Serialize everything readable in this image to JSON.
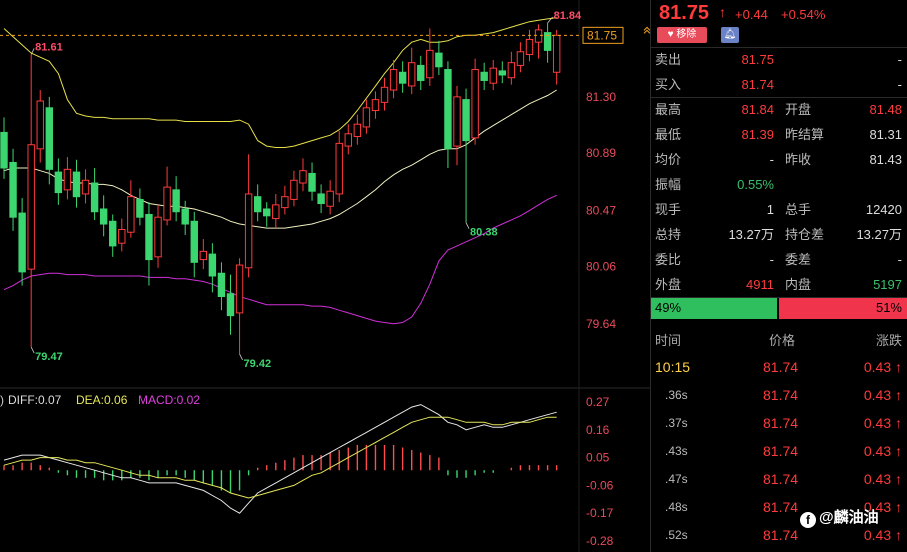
{
  "quote": {
    "price": "81.75",
    "arrow": "↑",
    "change": "+0.44",
    "change_pct": "+0.54%",
    "remove_label": "移除",
    "bell_icon": "bell-icon"
  },
  "stats": [
    {
      "l1": "卖出",
      "v1": "81.75",
      "c1": "red",
      "l2": "",
      "v2": "-",
      "c2": "white"
    },
    {
      "l1": "买入",
      "v1": "81.74",
      "c1": "red",
      "l2": "",
      "v2": "-",
      "c2": "white"
    },
    {
      "l1": "最高",
      "v1": "81.84",
      "c1": "red",
      "l2": "开盘",
      "v2": "81.48",
      "c2": "red"
    },
    {
      "l1": "最低",
      "v1": "81.39",
      "c1": "red",
      "l2": "昨结算",
      "v2": "81.31",
      "c2": "white"
    },
    {
      "l1": "均价",
      "v1": "-",
      "c1": "white",
      "l2": "昨收",
      "v2": "81.43",
      "c2": "white"
    },
    {
      "l1": "振幅",
      "v1": "0.55%",
      "c1": "green",
      "l2": "",
      "v2": "",
      "c2": "white"
    },
    {
      "l1": "现手",
      "v1": "1",
      "c1": "white",
      "l2": "总手",
      "v2": "12420",
      "c2": "white"
    },
    {
      "l1": "总持",
      "v1": "13.27万",
      "c1": "white",
      "l2": "持仓差",
      "v2": "13.27万",
      "c2": "white"
    },
    {
      "l1": "委比",
      "v1": "-",
      "c1": "white",
      "l2": "委差",
      "v2": "-",
      "c2": "white"
    },
    {
      "l1": "外盘",
      "v1": "4911",
      "c1": "red",
      "l2": "内盘",
      "v2": "5197",
      "c2": "green"
    }
  ],
  "ratio": {
    "buy_pct": 49,
    "buy_label": "49%",
    "sell_label": "51%"
  },
  "trades_header": {
    "time": "时间",
    "price": "价格",
    "change": "涨跌"
  },
  "trades": [
    {
      "time": "10:15",
      "price": "81.74",
      "change": "0.43"
    },
    {
      "time": ".36s",
      "price": "81.74",
      "change": "0.43"
    },
    {
      "time": ".37s",
      "price": "81.74",
      "change": "0.43"
    },
    {
      "time": ".43s",
      "price": "81.74",
      "change": "0.43"
    },
    {
      "time": ".47s",
      "price": "81.74",
      "change": "0.43"
    },
    {
      "time": ".48s",
      "price": "81.74",
      "change": "0.43"
    },
    {
      "time": ".52s",
      "price": "81.74",
      "change": "0.43"
    }
  ],
  "trade_arrow": "↑",
  "watermark": {
    "text": "@麟油油",
    "icon_text": "f"
  },
  "chart_data": [
    {
      "type": "candlestick",
      "ylim": [
        79.2,
        81.95
      ],
      "y_ticks": [
        81.3,
        80.89,
        80.47,
        80.06,
        79.64
      ],
      "y_tick_labels": [
        "81.30",
        "80.89",
        "80.47",
        "80.06",
        "79.64"
      ],
      "current_price": 81.75,
      "current_price_label": "81.75",
      "annotations": [
        {
          "label": "81.84",
          "index": 60,
          "value": 81.84,
          "color": "#ff4d6a"
        },
        {
          "label": "81.61",
          "index": 3,
          "value": 81.61,
          "color": "#ff4d6a"
        },
        {
          "label": "80.38",
          "index": 51,
          "value": 80.38,
          "color": "#3cd670"
        },
        {
          "label": "79.47",
          "index": 3,
          "value": 79.47,
          "color": "#3cd670"
        },
        {
          "label": "79.42",
          "index": 26,
          "value": 79.42,
          "color": "#3cd670"
        }
      ],
      "candles": [
        [
          81.04,
          80.78,
          81.15,
          80.7
        ],
        [
          80.82,
          80.42,
          80.92,
          80.32
        ],
        [
          80.45,
          80.02,
          80.56,
          79.92
        ],
        [
          80.04,
          80.95,
          81.61,
          79.47
        ],
        [
          80.92,
          81.27,
          81.35,
          80.82
        ],
        [
          81.22,
          80.77,
          81.3,
          80.66
        ],
        [
          80.75,
          80.6,
          80.85,
          80.51
        ],
        [
          80.62,
          80.77,
          80.86,
          80.55
        ],
        [
          80.75,
          80.57,
          80.84,
          80.49
        ],
        [
          80.59,
          80.69,
          80.77,
          80.52
        ],
        [
          80.67,
          80.46,
          80.78,
          80.4
        ],
        [
          80.48,
          80.37,
          80.58,
          80.28
        ],
        [
          80.39,
          80.21,
          80.44,
          80.13
        ],
        [
          80.23,
          80.33,
          80.41,
          80.17
        ],
        [
          80.31,
          80.57,
          80.69,
          80.27
        ],
        [
          80.55,
          80.42,
          80.63,
          80.36
        ],
        [
          80.44,
          80.11,
          80.53,
          79.92
        ],
        [
          80.13,
          80.42,
          80.51,
          80.05
        ],
        [
          80.4,
          80.64,
          80.79,
          80.36
        ],
        [
          80.62,
          80.46,
          80.72,
          80.39
        ],
        [
          80.48,
          80.37,
          80.54,
          80.29
        ],
        [
          80.39,
          80.09,
          80.46,
          79.98
        ],
        [
          80.11,
          80.17,
          80.26,
          80.04
        ],
        [
          80.15,
          79.99,
          80.23,
          79.87
        ],
        [
          80.01,
          79.84,
          80.09,
          79.74
        ],
        [
          79.86,
          79.7,
          80.0,
          79.56
        ],
        [
          79.72,
          80.07,
          80.12,
          79.42
        ],
        [
          80.05,
          80.59,
          80.88,
          79.98
        ],
        [
          80.57,
          80.46,
          80.66,
          80.39
        ],
        [
          80.48,
          80.43,
          80.53,
          80.35
        ],
        [
          80.41,
          80.51,
          80.59,
          80.34
        ],
        [
          80.49,
          80.57,
          80.65,
          80.44
        ],
        [
          80.55,
          80.69,
          80.76,
          80.5
        ],
        [
          80.67,
          80.76,
          80.85,
          80.61
        ],
        [
          80.74,
          80.61,
          80.82,
          80.54
        ],
        [
          80.59,
          80.52,
          80.66,
          80.45
        ],
        [
          80.5,
          80.61,
          80.69,
          80.44
        ],
        [
          80.59,
          80.96,
          81.05,
          80.53
        ],
        [
          80.94,
          81.03,
          81.1,
          80.88
        ],
        [
          81.01,
          81.1,
          81.17,
          80.95
        ],
        [
          81.08,
          81.22,
          81.28,
          81.03
        ],
        [
          81.2,
          81.28,
          81.34,
          81.14
        ],
        [
          81.26,
          81.37,
          81.44,
          81.2
        ],
        [
          81.35,
          81.5,
          81.57,
          81.29
        ],
        [
          81.48,
          81.4,
          81.56,
          81.33
        ],
        [
          81.38,
          81.55,
          81.66,
          81.32
        ],
        [
          81.53,
          81.42,
          81.6,
          81.35
        ],
        [
          81.44,
          81.64,
          81.8,
          81.38
        ],
        [
          81.62,
          81.52,
          81.71,
          81.46
        ],
        [
          81.5,
          80.92,
          81.56,
          80.78
        ],
        [
          80.94,
          81.3,
          81.38,
          80.8
        ],
        [
          81.28,
          80.98,
          81.36,
          80.38
        ],
        [
          81.0,
          81.5,
          81.58,
          80.95
        ],
        [
          81.48,
          81.42,
          81.55,
          81.35
        ],
        [
          81.4,
          81.51,
          81.57,
          81.35
        ],
        [
          81.49,
          81.46,
          81.56,
          81.4
        ],
        [
          81.44,
          81.55,
          81.63,
          81.39
        ],
        [
          81.53,
          81.63,
          81.7,
          81.48
        ],
        [
          81.61,
          81.72,
          81.79,
          81.56
        ],
        [
          81.7,
          81.79,
          81.83,
          81.58
        ],
        [
          81.77,
          81.64,
          81.84,
          81.55
        ],
        [
          81.48,
          81.75,
          81.79,
          81.39
        ]
      ],
      "bb_upper": [
        81.8,
        81.74,
        81.68,
        81.62,
        81.59,
        81.56,
        81.47,
        81.28,
        81.18,
        81.16,
        81.15,
        81.15,
        81.14,
        81.14,
        81.14,
        81.14,
        81.14,
        81.13,
        81.13,
        81.13,
        81.12,
        81.12,
        81.12,
        81.12,
        81.12,
        81.12,
        81.13,
        81.1,
        80.98,
        80.94,
        80.93,
        80.93,
        80.94,
        80.96,
        80.98,
        81.0,
        81.02,
        81.06,
        81.12,
        81.2,
        81.29,
        81.38,
        81.47,
        81.55,
        81.64,
        81.7,
        81.72,
        81.7,
        81.7,
        81.71,
        81.74,
        81.75,
        81.75,
        81.76,
        81.77,
        81.79,
        81.81,
        81.83,
        81.85,
        81.86,
        81.87,
        81.88
      ],
      "bb_mid": [
        80.76,
        80.78,
        80.78,
        80.78,
        80.76,
        80.74,
        80.7,
        80.68,
        80.67,
        80.67,
        80.66,
        80.66,
        80.65,
        80.62,
        80.58,
        80.55,
        80.52,
        80.51,
        80.5,
        80.5,
        80.49,
        80.48,
        80.46,
        80.44,
        80.42,
        80.39,
        80.37,
        80.36,
        80.35,
        80.34,
        80.34,
        80.34,
        80.35,
        80.36,
        80.37,
        80.39,
        80.41,
        80.44,
        80.48,
        80.52,
        80.57,
        80.62,
        80.68,
        80.73,
        80.77,
        80.8,
        80.84,
        80.88,
        80.91,
        80.92,
        80.92,
        80.95,
        81.0,
        81.05,
        81.09,
        81.13,
        81.17,
        81.21,
        81.25,
        81.28,
        81.31,
        81.35
      ],
      "bb_lower": [
        79.89,
        79.92,
        79.96,
        79.99,
        80.0,
        80.01,
        80.01,
        80.0,
        80.0,
        80.0,
        79.99,
        79.99,
        79.99,
        79.99,
        79.99,
        79.99,
        79.98,
        79.98,
        79.98,
        79.97,
        79.97,
        79.96,
        79.95,
        79.93,
        79.9,
        79.87,
        79.84,
        79.82,
        79.8,
        79.78,
        79.78,
        79.78,
        79.78,
        79.78,
        79.77,
        79.77,
        79.76,
        79.74,
        79.72,
        79.7,
        79.68,
        79.66,
        79.65,
        79.64,
        79.65,
        79.69,
        79.79,
        79.93,
        80.1,
        80.18,
        80.21,
        80.24,
        80.27,
        80.3,
        80.34,
        80.37,
        80.4,
        80.43,
        80.47,
        80.51,
        80.55,
        80.58
      ]
    },
    {
      "type": "macd",
      "legend_prefix": ")",
      "legend": [
        {
          "label": "DIFF:0.07",
          "color": "#dddddd"
        },
        {
          "label": "DEA:0.06",
          "color": "#e6e65a"
        },
        {
          "label": "MACD:0.02",
          "color": "#e040e0"
        }
      ],
      "ylim": [
        -0.3,
        0.29
      ],
      "y_ticks": [
        0.27,
        0.16,
        0.05,
        -0.06,
        -0.17,
        -0.28
      ],
      "y_tick_labels": [
        "0.27",
        "0.16",
        "0.05",
        "-0.06",
        "-0.17",
        "-0.28"
      ],
      "hist": [
        0.02,
        0.02,
        0.03,
        0.03,
        0.02,
        0.01,
        -0.01,
        -0.02,
        -0.03,
        -0.03,
        -0.03,
        -0.04,
        -0.04,
        -0.04,
        -0.03,
        -0.03,
        -0.04,
        -0.03,
        -0.02,
        -0.02,
        -0.03,
        -0.04,
        -0.05,
        -0.06,
        -0.08,
        -0.09,
        -0.08,
        -0.02,
        0.01,
        0.02,
        0.03,
        0.04,
        0.05,
        0.06,
        0.06,
        0.06,
        0.07,
        0.08,
        0.09,
        0.1,
        0.1,
        0.1,
        0.1,
        0.1,
        0.09,
        0.08,
        0.07,
        0.06,
        0.05,
        -0.02,
        -0.03,
        -0.03,
        -0.02,
        -0.01,
        -0.01,
        0.0,
        0.01,
        0.02,
        0.02,
        0.02,
        0.02,
        0.02
      ],
      "diff": [
        0.04,
        0.05,
        0.06,
        0.06,
        0.06,
        0.05,
        0.04,
        0.03,
        0.02,
        0.01,
        0.0,
        -0.01,
        -0.02,
        -0.03,
        -0.03,
        -0.04,
        -0.05,
        -0.05,
        -0.05,
        -0.05,
        -0.06,
        -0.07,
        -0.08,
        -0.1,
        -0.12,
        -0.15,
        -0.17,
        -0.13,
        -0.09,
        -0.07,
        -0.05,
        -0.03,
        -0.01,
        0.01,
        0.03,
        0.05,
        0.07,
        0.09,
        0.11,
        0.13,
        0.15,
        0.17,
        0.19,
        0.21,
        0.23,
        0.25,
        0.26,
        0.24,
        0.22,
        0.19,
        0.18,
        0.16,
        0.17,
        0.18,
        0.17,
        0.17,
        0.18,
        0.19,
        0.2,
        0.21,
        0.22,
        0.23
      ],
      "dea": [
        0.02,
        0.03,
        0.04,
        0.04,
        0.05,
        0.05,
        0.05,
        0.04,
        0.04,
        0.03,
        0.03,
        0.02,
        0.01,
        0.0,
        -0.01,
        -0.02,
        -0.02,
        -0.03,
        -0.03,
        -0.03,
        -0.04,
        -0.04,
        -0.05,
        -0.06,
        -0.07,
        -0.09,
        -0.1,
        -0.11,
        -0.1,
        -0.09,
        -0.08,
        -0.07,
        -0.06,
        -0.04,
        -0.02,
        -0.01,
        0.01,
        0.03,
        0.05,
        0.07,
        0.09,
        0.11,
        0.13,
        0.15,
        0.17,
        0.19,
        0.2,
        0.21,
        0.21,
        0.21,
        0.2,
        0.19,
        0.19,
        0.19,
        0.18,
        0.18,
        0.19,
        0.19,
        0.19,
        0.2,
        0.21,
        0.21
      ]
    }
  ]
}
